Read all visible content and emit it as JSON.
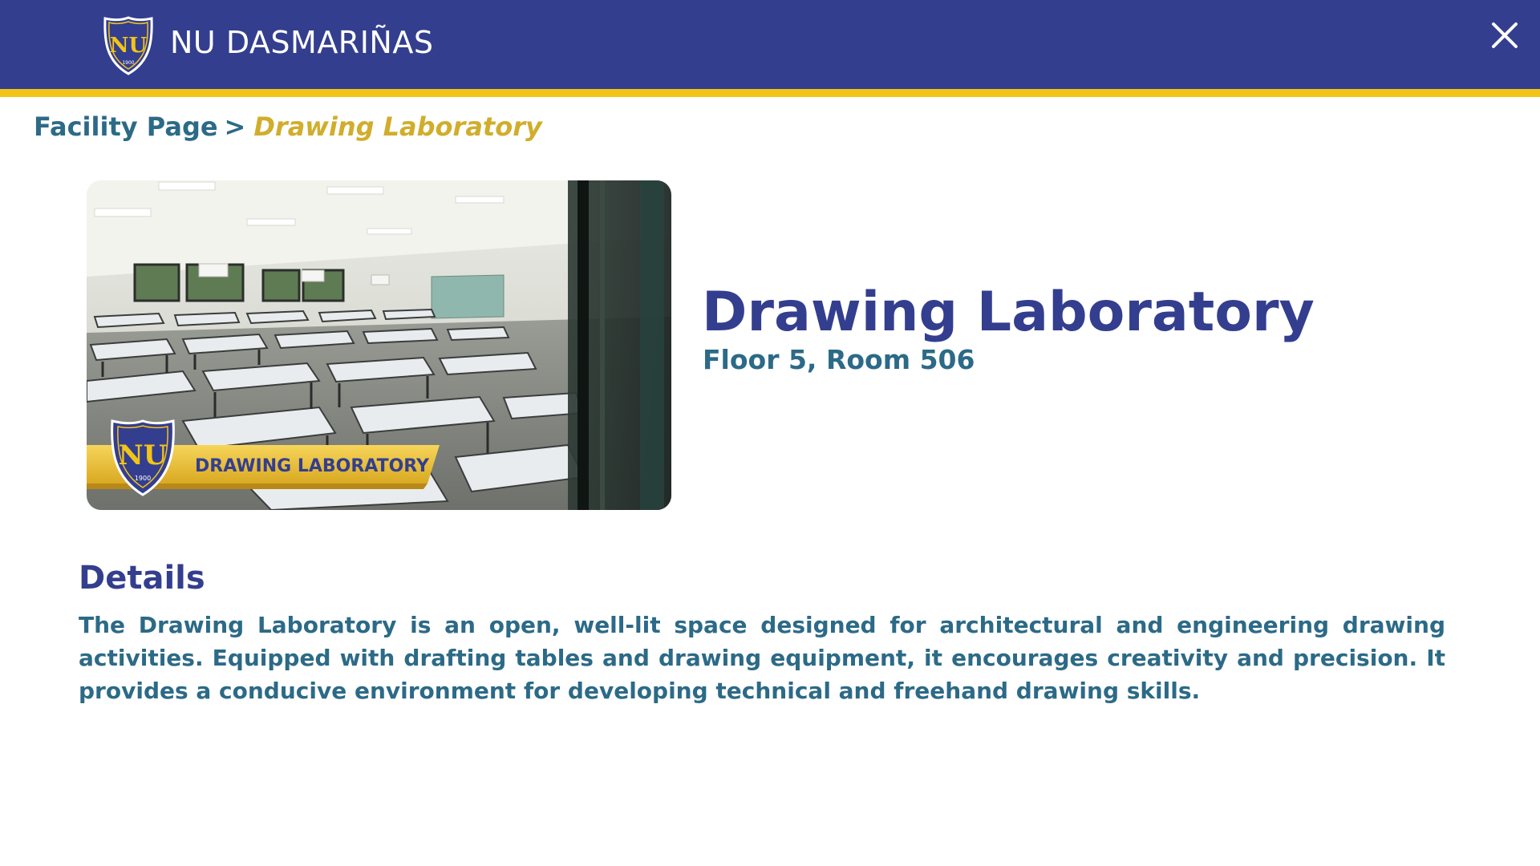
{
  "header": {
    "brand": "NU DASMARIÑAS",
    "logo": {
      "icon": "nu-shield-logo-icon",
      "monogram": "NU",
      "year": "1900"
    },
    "close_icon": "close-icon",
    "colors": {
      "background": "#343e8f",
      "stripe": "#f2c418"
    }
  },
  "breadcrumb": {
    "parent": "Facility Page",
    "separator": ">",
    "current": "Drawing Laboratory"
  },
  "hero_image": {
    "alt": "Drawing laboratory room with drafting tables",
    "banner_text": "DRAWING LABORATORY",
    "logo_monogram": "NU",
    "logo_year": "1900"
  },
  "facility": {
    "title": "Drawing Laboratory",
    "location": "Floor 5, Room 506"
  },
  "details": {
    "heading": "Details",
    "body": "The Drawing Laboratory is an open, well-lit space designed for architectural and engineering drawing activities. Equipped with drafting tables and drawing equipment, it encourages creativity and precision. It provides a conducive environment for developing technical and freehand drawing skills."
  },
  "colors": {
    "primary": "#343e8f",
    "accent": "#f2c418",
    "secondary_text": "#2c6a87",
    "breadcrumb_current": "#d1ad2c"
  }
}
